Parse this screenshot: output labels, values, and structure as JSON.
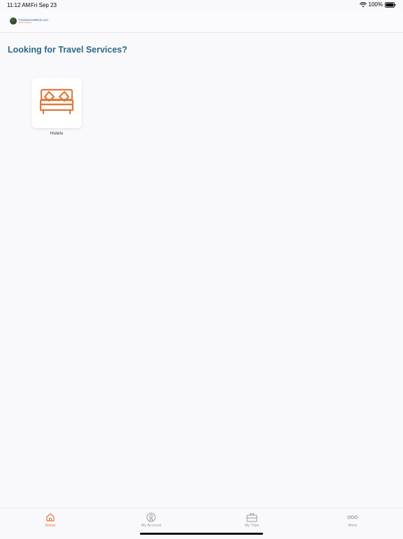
{
  "status_bar": {
    "time": "11:12 AM",
    "date": "Fri Sep 23",
    "battery": "100%",
    "icons": [
      "wifi-icon",
      "battery-icon"
    ]
  },
  "header": {
    "logo_text": "TravelStreetBlvd.com",
    "logo_subtext": "travel booking"
  },
  "main": {
    "title": "Looking for Travel Services?",
    "services": [
      {
        "label": "Hotels",
        "icon": "bed-icon"
      }
    ]
  },
  "tabs": [
    {
      "label": "Home",
      "icon": "home-icon",
      "active": true
    },
    {
      "label": "My Account",
      "icon": "account-icon",
      "active": false
    },
    {
      "label": "My Trips",
      "icon": "briefcase-icon",
      "active": false
    },
    {
      "label": "More",
      "icon": "more-icon",
      "active": false
    }
  ],
  "colors": {
    "accent": "#e07a3a",
    "title": "#2b6a85",
    "background": "#f9f8fb"
  }
}
